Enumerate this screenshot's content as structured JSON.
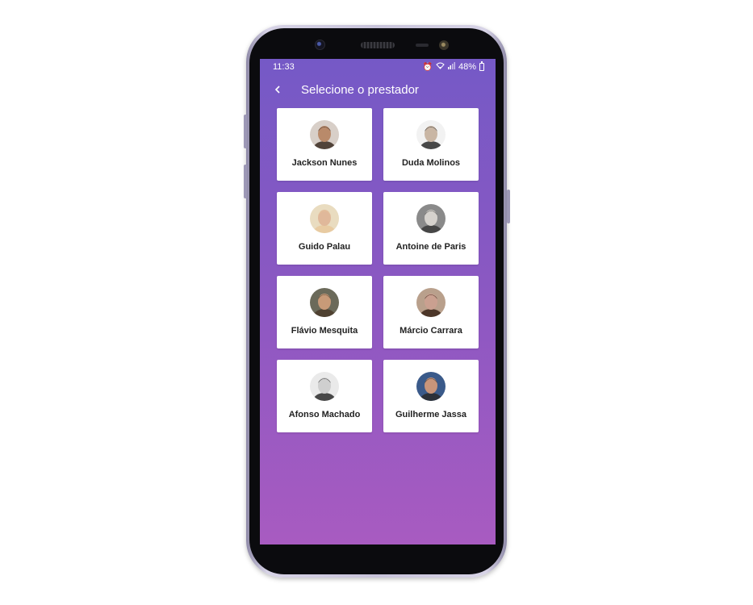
{
  "status_bar": {
    "time": "11:33",
    "battery": "48%",
    "icons": [
      "alarm-icon",
      "wifi-icon",
      "signal-icon",
      "battery-icon"
    ]
  },
  "header": {
    "title": "Selecione o prestador",
    "back_icon": "back-arrow-icon"
  },
  "colors": {
    "gradient_top": "#7559c6",
    "gradient_bottom": "#a85bc1",
    "card_bg": "#ffffff",
    "name_text": "#222222"
  },
  "providers": [
    {
      "name": "Jackson Nunes",
      "avatar": "avatar-photo",
      "tone": "#b98a6a",
      "hair": "#3a2a20",
      "bg": "#d8cfc8"
    },
    {
      "name": "Duda Molinos",
      "avatar": "avatar-photo",
      "tone": "#c9b6a4",
      "hair": "#2a2a2a",
      "bg": "#f2f2f2"
    },
    {
      "name": "Guido Palau",
      "avatar": "avatar-photo",
      "tone": "#e0b89a",
      "hair": "#e8c89c",
      "bg": "#e9dcc0"
    },
    {
      "name": "Antoine de Paris",
      "avatar": "avatar-photo",
      "tone": "#d6d2cd",
      "hair": "#3a3a3a",
      "bg": "#8a8a8a"
    },
    {
      "name": "Flávio Mesquita",
      "avatar": "avatar-photo",
      "tone": "#c89a78",
      "hair": "#4a3a2a",
      "bg": "#6b6a5a"
    },
    {
      "name": "Márcio Carrara",
      "avatar": "avatar-photo",
      "tone": "#caa090",
      "hair": "#3a2418",
      "bg": "#b9a08c"
    },
    {
      "name": "Afonso Machado",
      "avatar": "avatar-photo",
      "tone": "#cfcfcf",
      "hair": "#2a2a2a",
      "bg": "#eaeaea"
    },
    {
      "name": "Guilherme Jassa",
      "avatar": "avatar-photo",
      "tone": "#c8957a",
      "hair": "#2a2a2a",
      "bg": "#3a5a8a"
    }
  ]
}
